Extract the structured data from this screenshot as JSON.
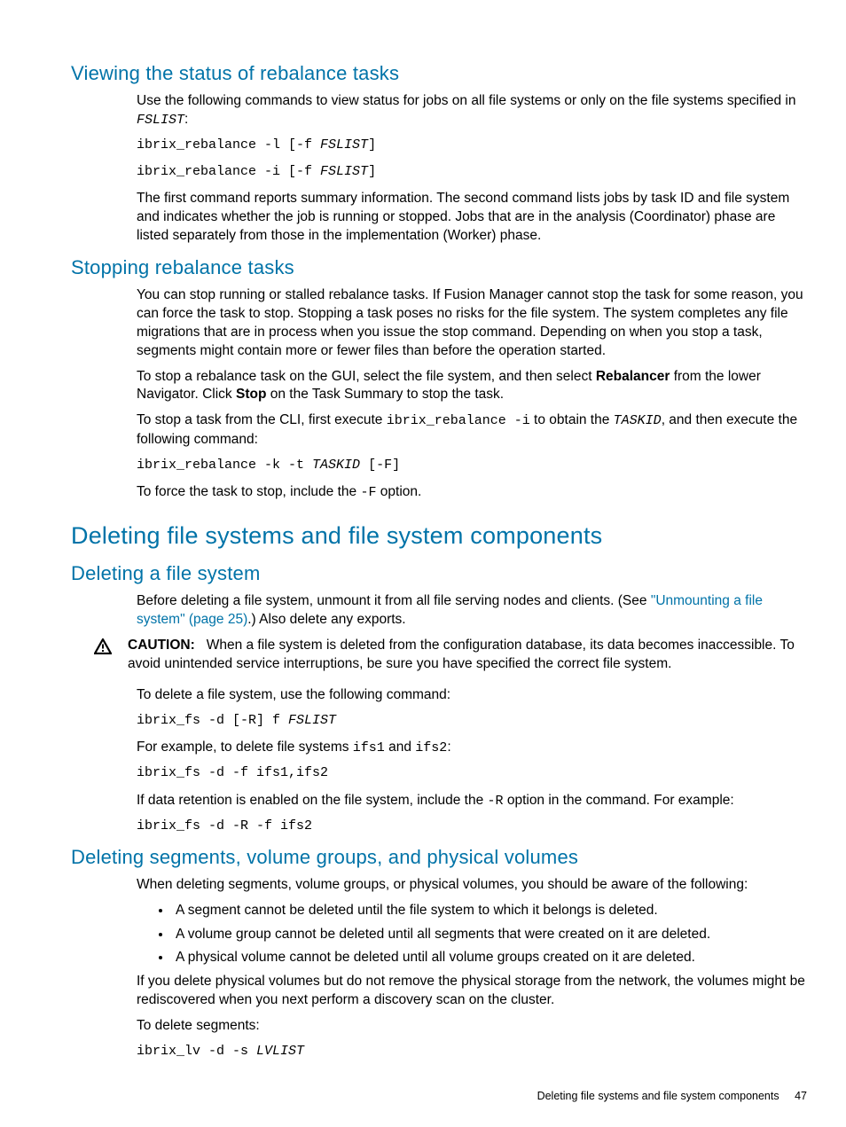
{
  "s1": {
    "heading": "Viewing the status of rebalance tasks",
    "p1a": "Use the following commands to view status for jobs on all file systems or only on the file systems specified in ",
    "p1code": "FSLIST",
    "p1b": ":",
    "cmd1a": "ibrix_rebalance -l [-f ",
    "cmd1b": "FSLIST",
    "cmd1c": "]",
    "cmd2a": "ibrix_rebalance -i [-f ",
    "cmd2b": "FSLIST",
    "cmd2c": "]",
    "p2": "The first command reports summary information. The second command lists jobs by task ID and file system and indicates whether the job is running or stopped. Jobs that are in the analysis (Coordinator) phase are listed separately from those in the implementation (Worker) phase."
  },
  "s2": {
    "heading": "Stopping rebalance tasks",
    "p1": "You can stop running or stalled rebalance tasks. If Fusion Manager cannot stop the task for some reason, you can force the task to stop. Stopping a task poses no risks for the file system. The system completes any file migrations that are in process when you issue the stop command. Depending on when you stop a task, segments might contain more or fewer files than before the operation started.",
    "p2a": "To stop a rebalance task on the GUI, select the file system, and then select ",
    "p2b": "Rebalancer",
    "p2c": " from the lower Navigator. Click ",
    "p2d": "Stop",
    "p2e": " on the Task Summary to stop the task.",
    "p3a": "To stop a task from the CLI, first execute ",
    "p3cmd": "ibrix_rebalance -i",
    "p3b": " to obtain the ",
    "p3code": "TASKID",
    "p3c": ", and then execute the following command:",
    "cmd1a": "ibrix_rebalance -k -t ",
    "cmd1b": "TASKID",
    "cmd1c": " [-F]",
    "p4a": "To force the task to stop, include the ",
    "p4code": "-F",
    "p4b": " option."
  },
  "s3": {
    "heading": "Deleting file systems and file system components"
  },
  "s4": {
    "heading": "Deleting a file system",
    "p1a": "Before deleting a file system, unmount it from all file serving nodes and clients. (See ",
    "link": "\"Unmounting a file system\" (page 25)",
    "p1b": ".) Also delete any exports.",
    "caution_label": "CAUTION:",
    "caution_text": "When a file system is deleted from the configuration database, its data becomes inaccessible. To avoid unintended service interruptions, be sure you have specified the correct file system.",
    "p2": "To delete a file system, use the following command:",
    "cmd1a": "ibrix_fs -d [-R] f ",
    "cmd1b": "FSLIST",
    "p3a": "For example, to delete file systems ",
    "p3code1": "ifs1",
    "p3b": " and ",
    "p3code2": "ifs2",
    "p3c": ":",
    "cmd2": "ibrix_fs -d -f ifs1,ifs2",
    "p4a": "If data retention is enabled on the file system, include the ",
    "p4code": "-R",
    "p4b": " option in the command. For example:",
    "cmd3": "ibrix_fs -d -R -f ifs2"
  },
  "s5": {
    "heading": "Deleting segments, volume groups, and physical volumes",
    "p1": "When deleting segments, volume groups, or physical volumes, you should be aware of the following:",
    "bullets": [
      "A segment cannot be deleted until the file system to which it belongs is deleted.",
      "A volume group cannot be deleted until all segments that were created on it are deleted.",
      "A physical volume cannot be deleted until all volume groups created on it are deleted."
    ],
    "p2": "If you delete physical volumes but do not remove the physical storage from the network, the volumes might be rediscovered when you next perform a discovery scan on the cluster.",
    "p3": "To delete segments:",
    "cmd1a": "ibrix_lv -d -s ",
    "cmd1b": "LVLIST"
  },
  "footer": {
    "title": "Deleting file systems and file system components",
    "page": "47"
  }
}
